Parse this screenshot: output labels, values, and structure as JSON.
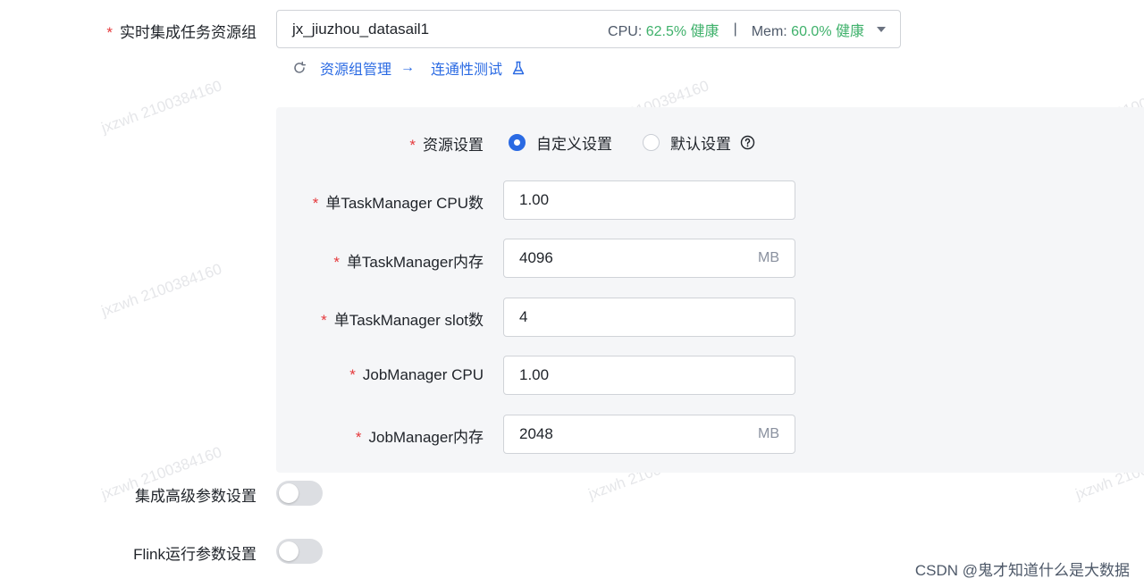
{
  "resource_group": {
    "label": "实时集成任务资源组",
    "value": "jx_jiuzhou_datasail1",
    "cpu_label": "CPU:",
    "cpu_value": "62.5% 健康",
    "separator": "|",
    "mem_label": "Mem:",
    "mem_value": "60.0% 健康",
    "manage_link": "资源组管理",
    "arrow": "→",
    "test_link": "连通性测试"
  },
  "resource_settings": {
    "label": "资源设置",
    "options": [
      {
        "label": "自定义设置",
        "checked": true
      },
      {
        "label": "默认设置",
        "checked": false
      }
    ]
  },
  "fields": [
    {
      "label": "单TaskManager CPU数",
      "value": "1.00",
      "unit": ""
    },
    {
      "label": "单TaskManager内存",
      "value": "4096",
      "unit": "MB"
    },
    {
      "label": "单TaskManager slot数",
      "value": "4",
      "unit": ""
    },
    {
      "label": "JobManager CPU",
      "value": "1.00",
      "unit": ""
    },
    {
      "label": "JobManager内存",
      "value": "2048",
      "unit": "MB"
    }
  ],
  "toggles": [
    {
      "label": "集成高级参数设置",
      "on": false
    },
    {
      "label": "Flink运行参数设置",
      "on": false
    }
  ],
  "required_mark": "*",
  "watermark_text": "jxzwh 2100384160",
  "credit": "CSDN @鬼才知道什么是大数据"
}
